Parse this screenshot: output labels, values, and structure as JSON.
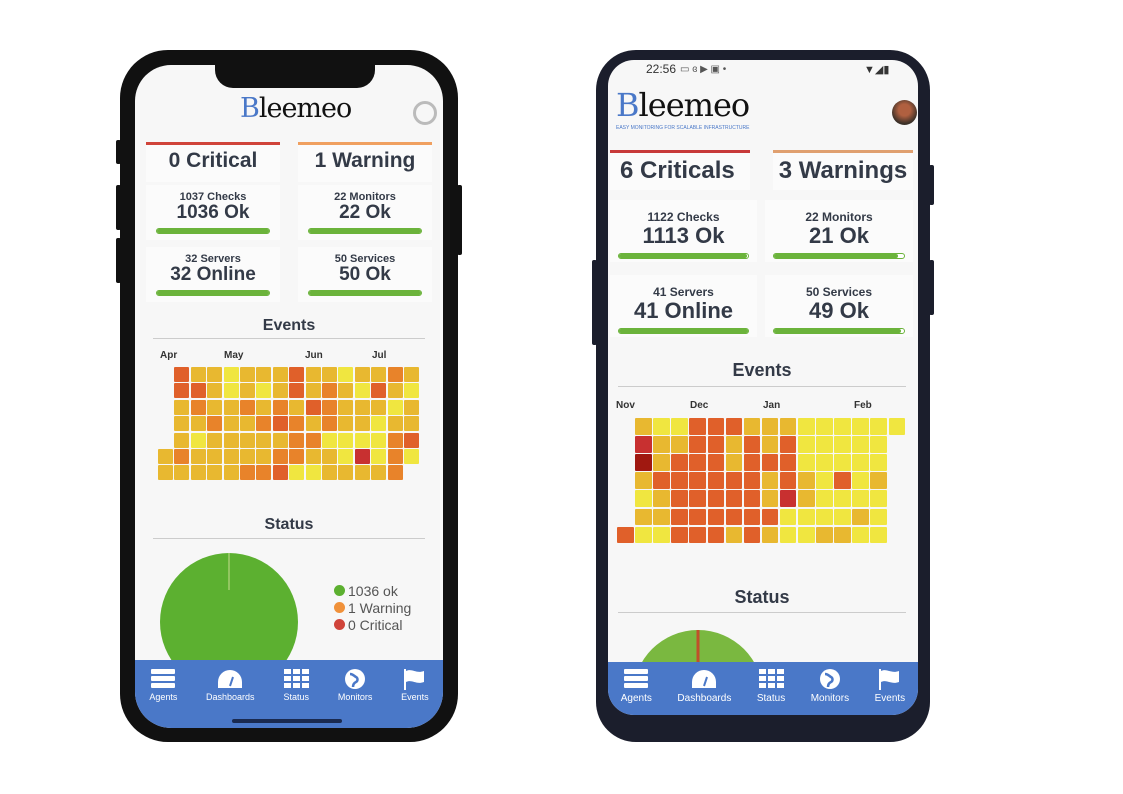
{
  "colors": {
    "nav": "#4a78c8",
    "ok": "#6bb33b",
    "critical": "#d0443a",
    "warning": "#f0913a",
    "heat": [
      "#f0e640",
      "#e8b830",
      "#e8832a",
      "#e0602a",
      "#c83030",
      "#a01810"
    ]
  },
  "iphone": {
    "logo_text": "Bleemeo",
    "summary": {
      "critical": "0 Critical",
      "warning": "1 Warning"
    },
    "stats": [
      {
        "label": "1037 Checks",
        "value": "1036 Ok",
        "progress": 0.999
      },
      {
        "label": "22 Monitors",
        "value": "22 Ok",
        "progress": 1.0
      },
      {
        "label": "32 Servers",
        "value": "32 Online",
        "progress": 1.0
      },
      {
        "label": "50 Services",
        "value": "50 Ok",
        "progress": 1.0
      }
    ],
    "events": {
      "title": "Events",
      "months": [
        "Apr",
        "May",
        "Jun",
        "Jul"
      ],
      "levels": [
        ".311011131101121",
        ".331010131210310",
        ".121121213211101",
        ".112112321211011",
        ".101111122000023",
        "1211111221104020",
        "111112230011112."
      ]
    },
    "status": {
      "title": "Status",
      "legend": [
        "1036 ok",
        "1 Warning",
        "0 Critical"
      ]
    },
    "nav": [
      "Agents",
      "Dashboards",
      "Status",
      "Monitors",
      "Events"
    ]
  },
  "android": {
    "status_bar": {
      "time": "22:56"
    },
    "logo_text": "Bleemeo",
    "logo_tagline": "EASY MONITORING FOR SCALABLE INFRASTRUCTURE",
    "summary": {
      "critical": "6 Criticals",
      "warning": "3 Warnings"
    },
    "stats": [
      {
        "label": "1122 Checks",
        "value": "1113 Ok",
        "progress": 0.992
      },
      {
        "label": "22 Monitors",
        "value": "21 Ok",
        "progress": 0.955
      },
      {
        "label": "41 Servers",
        "value": "41 Online",
        "progress": 1.0
      },
      {
        "label": "50 Services",
        "value": "49 Ok",
        "progress": 0.98
      }
    ],
    "events": {
      "title": "Events",
      "months": [
        "Nov",
        "Dec",
        "Jan",
        "Feb"
      ],
      "levels": [
        ".100333111000000",
        ".41133131300000.",
        ".51333133300000.",
        ".13333331310301.",
        ".01333331410000.",
        ".11333333000010.",
        "300333131001100."
      ]
    },
    "status": {
      "title": "Status"
    },
    "nav": [
      "Agents",
      "Dashboards",
      "Status",
      "Monitors",
      "Events"
    ]
  }
}
